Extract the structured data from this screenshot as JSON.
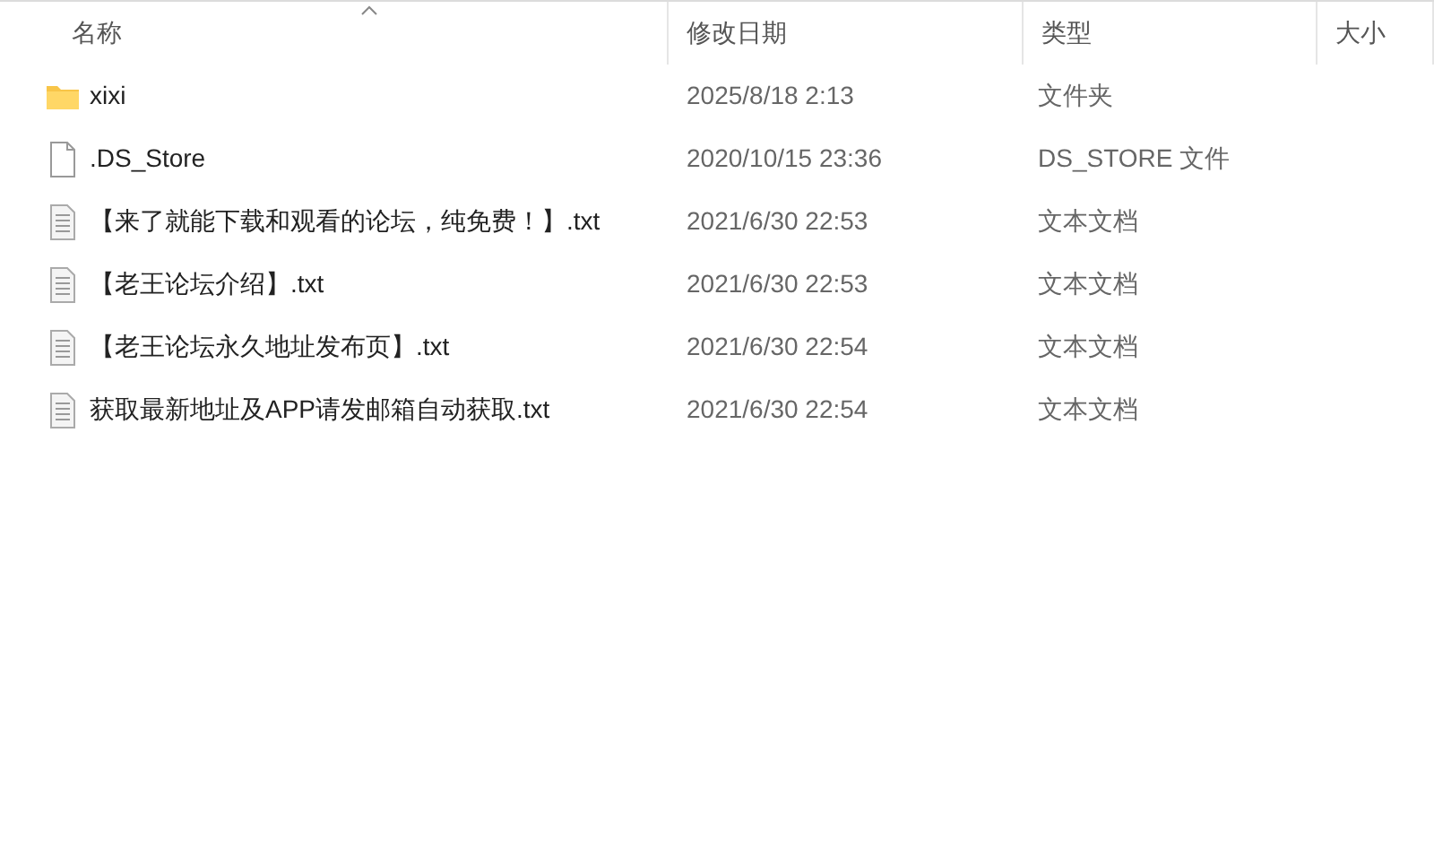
{
  "columns": [
    {
      "label": "名称",
      "sorted": true
    },
    {
      "label": "修改日期",
      "sorted": false
    },
    {
      "label": "类型",
      "sorted": false
    },
    {
      "label": "大小",
      "sorted": false
    }
  ],
  "rows": [
    {
      "kind": "folder",
      "name": "xixi",
      "date": "2025/8/18 2:13",
      "type": "文件夹"
    },
    {
      "kind": "file",
      "name": ".DS_Store",
      "date": "2020/10/15 23:36",
      "type": "DS_STORE 文件"
    },
    {
      "kind": "text",
      "name": "【来了就能下载和观看的论坛，纯免费！】.txt",
      "date": "2021/6/30 22:53",
      "type": "文本文档"
    },
    {
      "kind": "text",
      "name": "【老王论坛介绍】.txt",
      "date": "2021/6/30 22:53",
      "type": "文本文档"
    },
    {
      "kind": "text",
      "name": "【老王论坛永久地址发布页】.txt",
      "date": "2021/6/30 22:54",
      "type": "文本文档"
    },
    {
      "kind": "text",
      "name": "获取最新地址及APP请发邮箱自动获取.txt",
      "date": "2021/6/30 22:54",
      "type": "文本文档"
    }
  ]
}
